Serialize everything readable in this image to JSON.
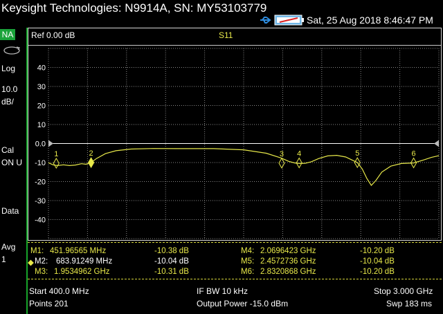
{
  "header": {
    "title": "Keysight Technologies: N9914A, SN: MY53103779",
    "datetime": "Sat, 25 Aug 2018 8:46:47 PM",
    "icons": [
      "usb-icon",
      "battery-icon"
    ]
  },
  "left_panel": {
    "mode": "NA",
    "scale_type": "Log",
    "scale_value": "10.0",
    "scale_unit": "dB/",
    "cal_label": "Cal",
    "cal_status": "ON U",
    "data_label": "Data",
    "avg_label": "Avg",
    "avg_value": "1"
  },
  "plot": {
    "ref_label": "Ref 0.00 dB",
    "parameter": "S11",
    "y_ticks": [
      "40",
      "30",
      "20",
      "10",
      "0.0",
      "-10",
      "-20",
      "-30",
      "-40"
    ],
    "trace_color": "#e8e94a"
  },
  "chart_data": {
    "type": "line",
    "x_unit": "MHz",
    "xlim": [
      400,
      3000
    ],
    "ylim": [
      -50,
      50
    ],
    "ref_level": 0,
    "grid": true,
    "series": [
      {
        "name": "S11",
        "x": [
          400,
          430,
          460,
          500,
          540,
          580,
          620,
          650,
          684,
          720,
          780,
          850,
          950,
          1100,
          1300,
          1500,
          1700,
          1850,
          1950,
          2000,
          2040,
          2070,
          2110,
          2150,
          2200,
          2260,
          2320,
          2380,
          2420,
          2457,
          2490,
          2520,
          2550,
          2580,
          2620,
          2680,
          2750,
          2832,
          2900,
          2950,
          3000
        ],
        "values": [
          -10.1,
          -11.2,
          -11.6,
          -11.2,
          -11.6,
          -11.3,
          -10.6,
          -10.9,
          -10.0,
          -7.9,
          -5.3,
          -3.8,
          -2.9,
          -2.6,
          -2.7,
          -2.7,
          -3.3,
          -5.1,
          -7.6,
          -9.4,
          -10.2,
          -10.5,
          -10.4,
          -9.6,
          -7.9,
          -6.5,
          -6.2,
          -7.1,
          -8.6,
          -10.0,
          -13.4,
          -18.3,
          -22.0,
          -19.5,
          -15.0,
          -11.9,
          -10.5,
          -10.2,
          -8.6,
          -7.3,
          -6.4
        ]
      }
    ],
    "markers": [
      {
        "id": "1",
        "label": "M1:",
        "freq": "451.96565 MHz",
        "value": "-10.38 dB",
        "x": 451.97,
        "y": -10.38,
        "active": false
      },
      {
        "id": "2",
        "label": "M2:",
        "freq": "683.91249 MHz",
        "value": "-10.04 dB",
        "x": 683.91,
        "y": -10.04,
        "active": true
      },
      {
        "id": "3",
        "label": "M3:",
        "freq": "1.9534962 GHz",
        "value": "-10.31 dB",
        "x": 1953.5,
        "y": -10.31,
        "active": false
      },
      {
        "id": "4",
        "label": "M4:",
        "freq": "2.0696423 GHz",
        "value": "-10.20 dB",
        "x": 2069.64,
        "y": -10.2,
        "active": false
      },
      {
        "id": "5",
        "label": "M5:",
        "freq": "2.4572736 GHz",
        "value": "-10.04 dB",
        "x": 2457.27,
        "y": -10.04,
        "active": false
      },
      {
        "id": "6",
        "label": "M6:",
        "freq": "2.8320868 GHz",
        "value": "-10.20 dB",
        "x": 2832.09,
        "y": -10.2,
        "active": false
      }
    ]
  },
  "footer": {
    "start": "Start 400.0 MHz",
    "points": "Points 201",
    "if_bw": "IF BW 10 kHz",
    "output_power": "Output Power -15.0 dBm",
    "stop": "Stop 3.000 GHz",
    "sweep": "Swp 183 ms"
  }
}
